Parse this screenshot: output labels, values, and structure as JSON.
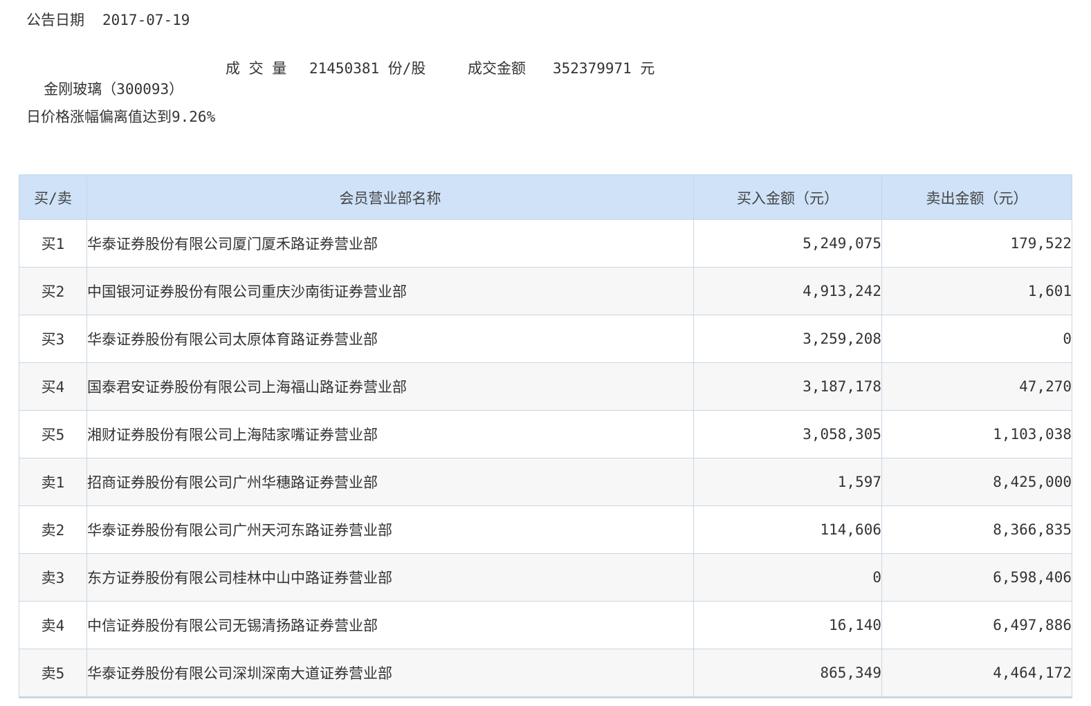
{
  "announcement": {
    "date_label": "公告日期",
    "date_value": "2017-07-19"
  },
  "stock": {
    "name_code": "金刚玻璃（300093）",
    "volume_label": "成 交 量",
    "volume_value": "21450381 份/股",
    "amount_label": "成交金额",
    "amount_value": "352379971 元"
  },
  "reason": "日价格涨幅偏离值达到9.26%",
  "table": {
    "headers": [
      "买/卖",
      "会员营业部名称",
      "买入金额（元）",
      "卖出金额（元）"
    ],
    "rows": [
      {
        "rank": "买1",
        "name": "华泰证券股份有限公司厦门厦禾路证券营业部",
        "buy": "5,249,075",
        "sell": "179,522"
      },
      {
        "rank": "买2",
        "name": "中国银河证券股份有限公司重庆沙南街证券营业部",
        "buy": "4,913,242",
        "sell": "1,601"
      },
      {
        "rank": "买3",
        "name": "华泰证券股份有限公司太原体育路证券营业部",
        "buy": "3,259,208",
        "sell": "0"
      },
      {
        "rank": "买4",
        "name": "国泰君安证券股份有限公司上海福山路证券营业部",
        "buy": "3,187,178",
        "sell": "47,270"
      },
      {
        "rank": "买5",
        "name": "湘财证券股份有限公司上海陆家嘴证券营业部",
        "buy": "3,058,305",
        "sell": "1,103,038"
      },
      {
        "rank": "卖1",
        "name": "招商证券股份有限公司广州华穗路证券营业部",
        "buy": "1,597",
        "sell": "8,425,000"
      },
      {
        "rank": "卖2",
        "name": "华泰证券股份有限公司广州天河东路证券营业部",
        "buy": "114,606",
        "sell": "8,366,835"
      },
      {
        "rank": "卖3",
        "name": "东方证券股份有限公司桂林中山中路证券营业部",
        "buy": "0",
        "sell": "6,598,406"
      },
      {
        "rank": "卖4",
        "name": "中信证券股份有限公司无锡清扬路证券营业部",
        "buy": "16,140",
        "sell": "6,497,886"
      },
      {
        "rank": "卖5",
        "name": "华泰证券股份有限公司深圳深南大道证券营业部",
        "buy": "865,349",
        "sell": "4,464,172"
      }
    ]
  }
}
